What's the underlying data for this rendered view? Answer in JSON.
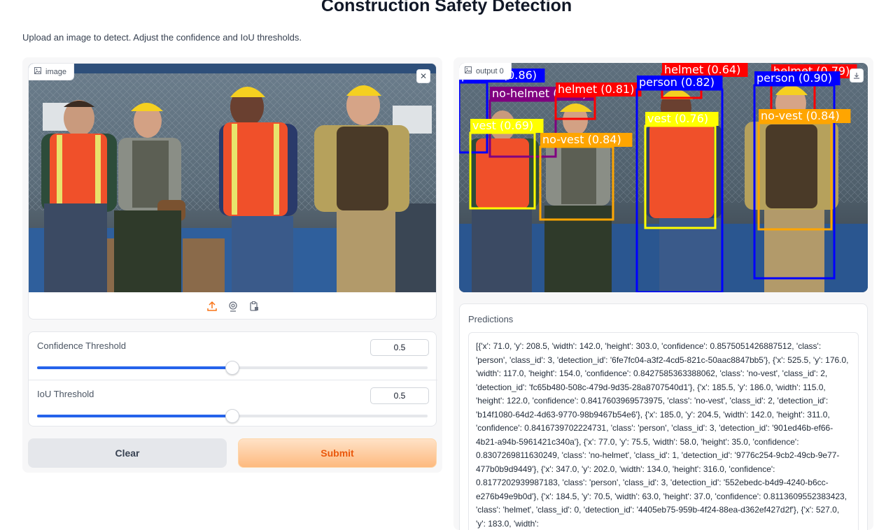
{
  "page": {
    "title": "Construction Safety Detection",
    "description": "Upload an image to detect. Adjust the confidence and IoU thresholds."
  },
  "input_image": {
    "label": "image",
    "label_icon": "image-icon",
    "clear_icon": "close-icon",
    "source_icons": [
      "upload-icon",
      "webcam-icon",
      "clipboard-icon"
    ],
    "content": "photo of four workers in hard hats and safety vests"
  },
  "sliders": [
    {
      "label": "Confidence Threshold",
      "value": "0.5",
      "fraction": 0.5
    },
    {
      "label": "IoU Threshold",
      "value": "0.5",
      "fraction": 0.5
    }
  ],
  "buttons": {
    "clear": "Clear",
    "submit": "Submit"
  },
  "output_image": {
    "label": "output 0",
    "download_icon": "download-icon",
    "detections": [
      {
        "label": "person (0.86)",
        "color": "#0000ff"
      },
      {
        "label": "no-helmet (0.83)",
        "color": "#800080"
      },
      {
        "label": "helmet (0.81)",
        "color": "#ff0000"
      },
      {
        "label": "vest (0.69)",
        "color": "#ffff00"
      },
      {
        "label": "no-vest (0.84)",
        "color": "#ffa500"
      },
      {
        "label": "helmet (0.64)",
        "color": "#ff0000"
      },
      {
        "label": "person (0.82)",
        "color": "#0000ff"
      },
      {
        "label": "vest (0.76)",
        "color": "#ffff00"
      },
      {
        "label": "helmet (0.79)",
        "color": "#ff0000"
      },
      {
        "label": "person (0.90)",
        "color": "#0000ff"
      },
      {
        "label": "no-vest (0.84)",
        "color": "#ffa500"
      }
    ]
  },
  "predictions": {
    "label": "Predictions",
    "text": "[{'x': 71.0, 'y': 208.5, 'width': 142.0, 'height': 303.0, 'confidence': 0.8575051426887512, 'class': 'person', 'class_id': 3, 'detection_id': '6fe7fc04-a3f2-4cd5-821c-50aac8847bb5'}, {'x': 525.5, 'y': 176.0, 'width': 117.0, 'height': 154.0, 'confidence': 0.8427585363388062, 'class': 'no-vest', 'class_id': 2, 'detection_id': 'fc65b480-508c-479d-9d35-28a8707540d1'}, {'x': 185.5, 'y': 186.0, 'width': 115.0, 'height': 122.0, 'confidence': 0.8417603969573975, 'class': 'no-vest', 'class_id': 2, 'detection_id': 'b14f1080-64d2-4d63-9770-98b9467b54e6'}, {'x': 185.0, 'y': 204.5, 'width': 142.0, 'height': 311.0, 'confidence': 0.8416739702224731, 'class': 'person', 'class_id': 3, 'detection_id': '901ed46b-ef66-4b21-a94b-5961421c340a'}, {'x': 77.0, 'y': 75.5, 'width': 58.0, 'height': 35.0, 'confidence': 0.8307269811630249, 'class': 'no-helmet', 'class_id': 1, 'detection_id': '9776c254-9cb2-49cb-9e77-477b0b9d9449'}, {'x': 347.0, 'y': 202.0, 'width': 134.0, 'height': 316.0, 'confidence': 0.8177202939987183, 'class': 'person', 'class_id': 3, 'detection_id': '552ebedc-b4d9-4240-b6cc-e276b49e9b0d'}, {'x': 184.5, 'y': 70.5, 'width': 63.0, 'height': 37.0, 'confidence': 0.8113609552383423, 'class': 'helmet', 'class_id': 0, 'detection_id': '4405eb75-959b-4f24-88ea-d362ef427d2f'}, {'x': 527.0, 'y': 183.0, 'width':"
  },
  "colors": {
    "accent": "#2563eb",
    "submit_text": "#ea580c",
    "submit_bg": "#fdba7f"
  }
}
